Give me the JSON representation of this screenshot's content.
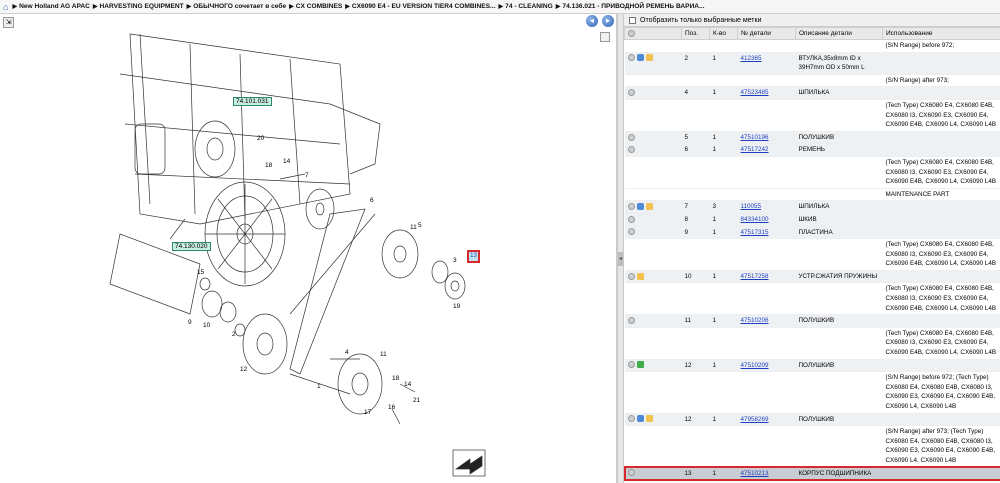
{
  "breadcrumb": [
    "New Holland AG APAC",
    "HARVESTING EQUIPMENT",
    "ОБЫЧНОГО сочетает в себе",
    "CX COMBINES",
    "CX6090 E4 - EU VERSION TIER4 COMBINES...",
    "74 - CLEANING",
    "74.136.021 - ПРИВОДНОЙ РЕМЕНЬ ВАРИА..."
  ],
  "icons": {
    "home": "home-icon",
    "back": "back-icon",
    "forward": "forward-icon",
    "expand": "expand-icon",
    "collapse": "collapse-icon",
    "page_nav": "page-nav-icon"
  },
  "filter_label": "Отобразить только выбранные метки",
  "columns": [
    "",
    "Поз.",
    "К-во",
    "№ детали",
    "Описание детали",
    "Использование"
  ],
  "callouts": {
    "a": "74.101.031",
    "b": "74.130.020",
    "highlight": "13"
  },
  "diagram_numbers": [
    "15",
    "10",
    "9",
    "2",
    "12",
    "14",
    "18",
    "7",
    "6",
    "20",
    "5",
    "3",
    "19",
    "1",
    "4",
    "11",
    "18",
    "14",
    "16",
    "17",
    "21",
    "11"
  ],
  "rows": [
    {
      "type": "note",
      "usage": "(S/N Range) before 972;"
    },
    {
      "type": "main",
      "icons": [
        "g",
        "b",
        "y"
      ],
      "pos": "2",
      "qty": "1",
      "part": "412365",
      "desc": "ВТУЛКА,35x8mm ID x 39H7mm OD x 50mm L",
      "usage": ""
    },
    {
      "type": "note",
      "usage": "(S/N Range) after 973;"
    },
    {
      "type": "main",
      "icons": [
        "g"
      ],
      "pos": "4",
      "qty": "1",
      "part": "47523485",
      "desc": "ШПИЛЬКА",
      "usage": ""
    },
    {
      "type": "note",
      "usage": "(Tech Type) CX6080 E4, CX6080 E4B, CX6080 I3, CX6090 E3, CX6090 E4, CX6090 E4B, CX6090 L4, CX6090 L4B"
    },
    {
      "type": "main",
      "icons": [
        "g"
      ],
      "pos": "5",
      "qty": "1",
      "part": "47510196",
      "desc": "ПОЛУШКИВ",
      "usage": ""
    },
    {
      "type": "main",
      "icons": [
        "g"
      ],
      "pos": "6",
      "qty": "1",
      "part": "47517242",
      "desc": "РЕМЕНЬ",
      "usage": ""
    },
    {
      "type": "note",
      "usage": "(Tech Type) CX6080 E4, CX6080 E4B, CX6080 I3, CX6090 E3, CX6090 E4, CX6090 E4B, CX6090 L4, CX6090 L4B"
    },
    {
      "type": "note",
      "usage": "MAINTENANCE PART"
    },
    {
      "type": "main",
      "icons": [
        "g",
        "b",
        "y"
      ],
      "pos": "7",
      "qty": "3",
      "part": "110055",
      "desc": "ШПИЛЬКА",
      "usage": ""
    },
    {
      "type": "main",
      "icons": [
        "g"
      ],
      "pos": "8",
      "qty": "1",
      "part": "84334100",
      "desc": "ШКИВ",
      "usage": ""
    },
    {
      "type": "main",
      "icons": [
        "g"
      ],
      "pos": "9",
      "qty": "1",
      "part": "47517315",
      "desc": "ПЛАСТИНА",
      "usage": ""
    },
    {
      "type": "note",
      "usage": "(Tech Type) CX6080 E4, CX6080 E4B, CX6080 I3, CX6090 E3, CX6090 E4, CX6090 E4B, CX6090 L4, CX6090 L4B"
    },
    {
      "type": "main",
      "icons": [
        "g",
        "y"
      ],
      "pos": "10",
      "qty": "1",
      "part": "47517258",
      "desc": "УСТР.СЖАТИЯ ПРУЖИНЫ",
      "usage": ""
    },
    {
      "type": "note",
      "usage": "(Tech Type) CX6080 E4, CX6080 E4B, CX6080 I3, CX6090 E3, CX6090 E4, CX6090 E4B, CX6090 L4, CX6090 L4B"
    },
    {
      "type": "main",
      "icons": [
        "g"
      ],
      "pos": "11",
      "qty": "1",
      "part": "47510206",
      "desc": "ПОЛУШКИВ",
      "usage": ""
    },
    {
      "type": "note",
      "usage": "(Tech Type) CX6080 E4, CX6080 E4B, CX6080 I3, CX6090 E3, CX6090 E4, CX6090 E4B, CX6090 L4, CX6090 L4B"
    },
    {
      "type": "main",
      "icons": [
        "g",
        "gr"
      ],
      "pos": "12",
      "qty": "1",
      "part": "47510209",
      "desc": "ПОЛУШКИВ",
      "usage": ""
    },
    {
      "type": "note",
      "usage": "(S/N Range) before 972; (Tech Type) CX6080 E4, CX6080 E4B, CX6080 I3, CX6090 E3, CX6090 E4, CX6090 E4B, CX6090 L4, CX6090 L4B"
    },
    {
      "type": "main",
      "icons": [
        "g",
        "b",
        "y"
      ],
      "pos": "12",
      "qty": "1",
      "part": "47958269",
      "desc": "ПОЛУШКИВ",
      "usage": ""
    },
    {
      "type": "note",
      "usage": "(S/N Range) after 973; (Tech Type) CX6080 E4, CX6080 E4B, CX6080 I3, CX6090 E3, CX6090 E4, CX6090 E4B, CX6090 L4, CX6090 L4B"
    },
    {
      "type": "sel",
      "icons": [
        "g"
      ],
      "pos": "13",
      "qty": "1",
      "part": "47510213",
      "desc": "КОРПУС ПОДШИПНИКА",
      "usage": ""
    }
  ]
}
